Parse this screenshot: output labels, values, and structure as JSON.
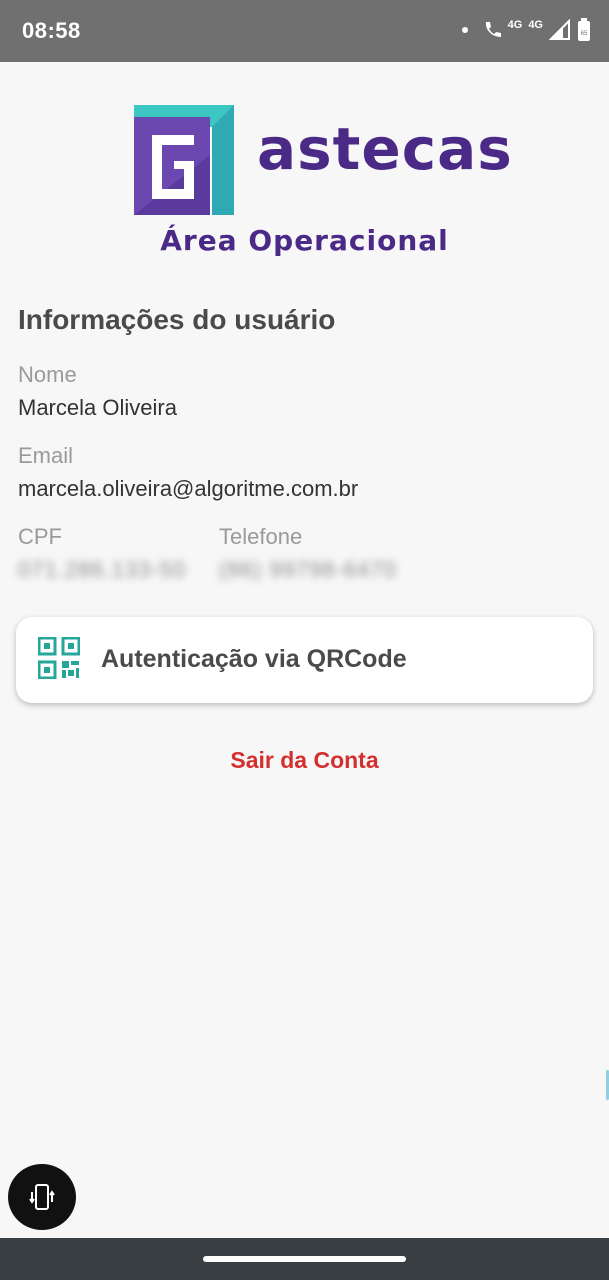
{
  "status_bar": {
    "time": "08:58",
    "network_1": "4G",
    "network_2": "4G",
    "battery_level": "65",
    "icons": [
      "notification-dot",
      "wifi-calling-icon",
      "signal-icon",
      "battery-icon"
    ]
  },
  "header": {
    "brand": "astecas",
    "subtitle": "Área Operacional"
  },
  "user_info": {
    "title": "Informações do usuário",
    "name_label": "Nome",
    "name_value": "Marcela Oliveira",
    "email_label": "Email",
    "email_value": "marcela.oliveira@algoritme.com.br",
    "cpf_label": "CPF",
    "cpf_value": "071.286.133-50",
    "phone_label": "Telefone",
    "phone_value": "(86) 99798-6470"
  },
  "actions": {
    "qr_auth_label": "Autenticação via QRCode",
    "logout_label": "Sair da Conta"
  },
  "colors": {
    "brand_purple": "#4a2a86",
    "brand_teal": "#3cc7c2",
    "qr_icon": "#26a69a",
    "logout_red": "#d32f2f"
  }
}
